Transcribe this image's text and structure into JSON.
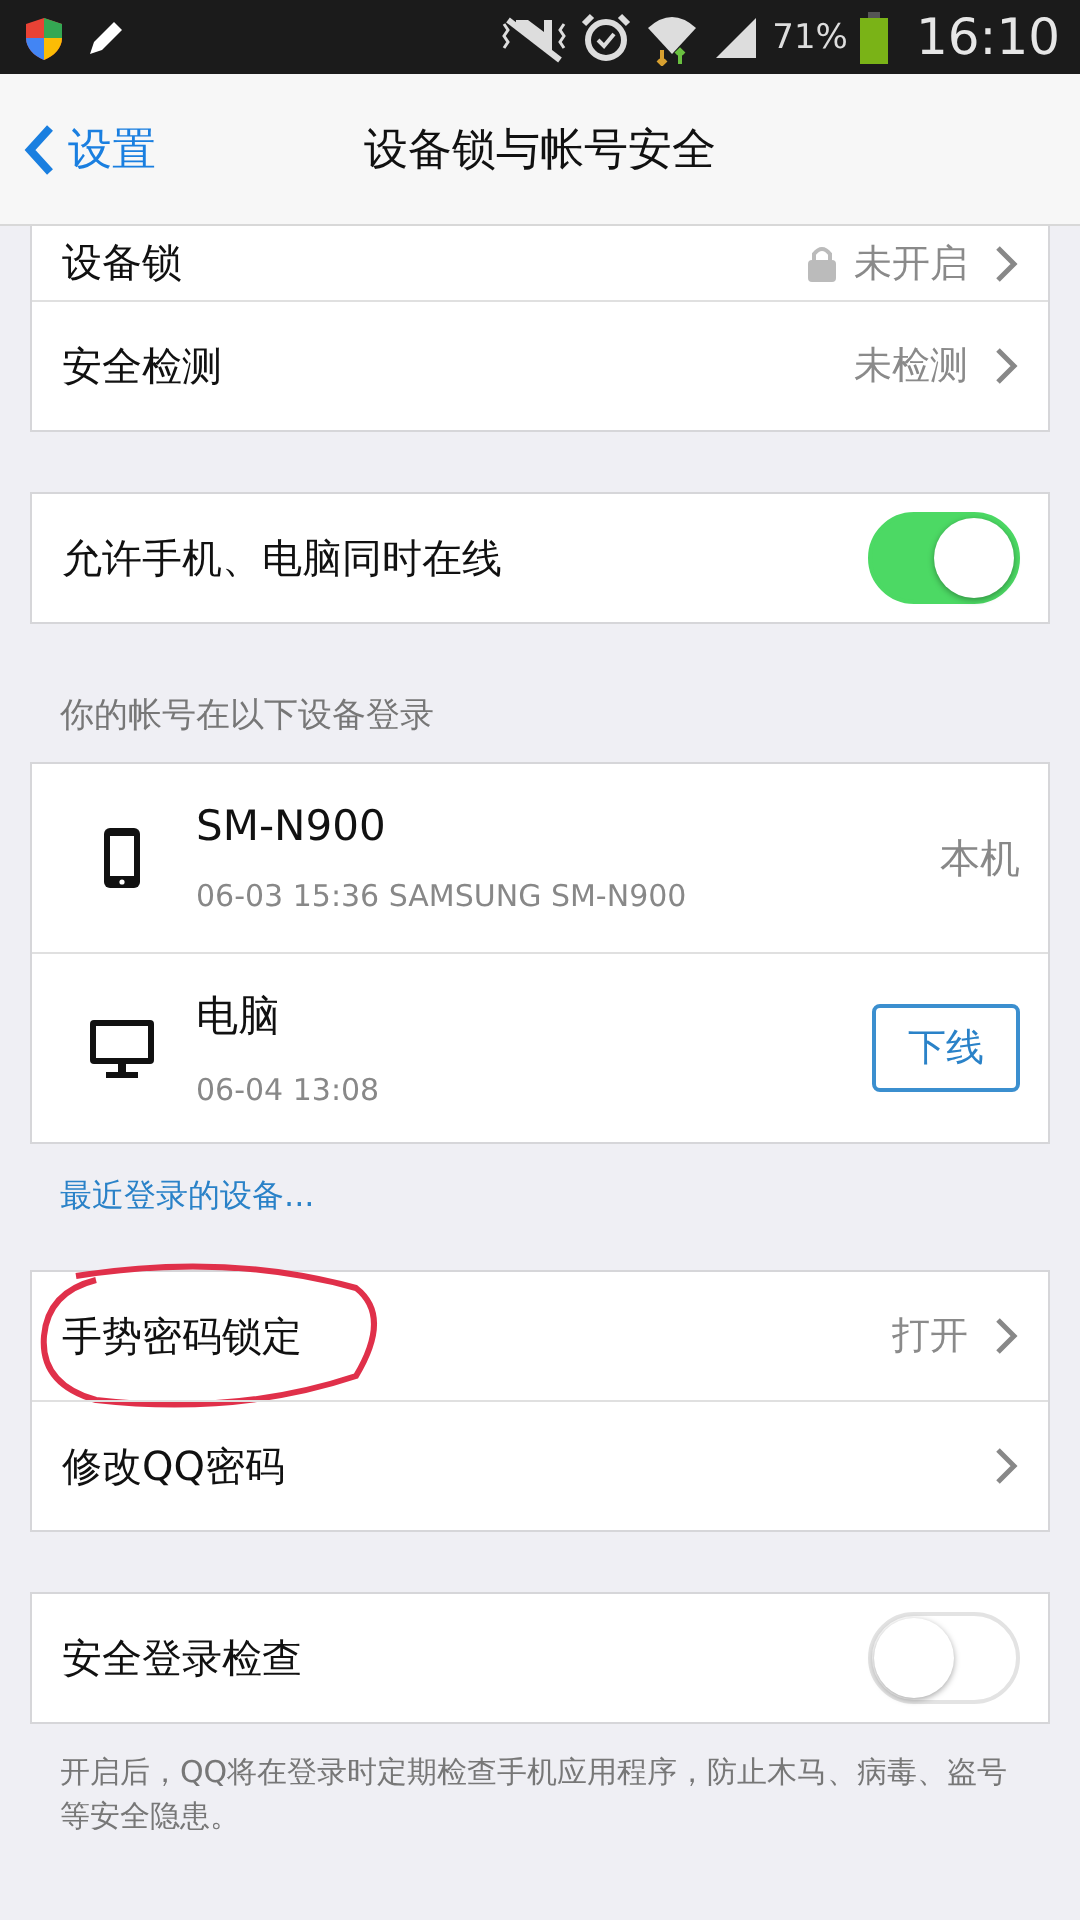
{
  "status_bar": {
    "battery": "71%",
    "time": "16:10"
  },
  "nav": {
    "back": "设置",
    "title": "设备锁与帐号安全"
  },
  "sections": [
    {
      "kind": "card",
      "rows": [
        {
          "kind": "locked",
          "label": "设备锁",
          "value": "未开启"
        },
        {
          "kind": "link",
          "label": "安全检测",
          "value": "未检测"
        }
      ]
    },
    {
      "kind": "card",
      "rows": [
        {
          "kind": "toggle",
          "label": "允许手机、电脑同时在线",
          "on": true
        }
      ]
    },
    {
      "kind": "header",
      "text": "你的帐号在以下设备登录"
    },
    {
      "kind": "devices",
      "items": [
        {
          "kind": "phone",
          "name": "SM-N900",
          "detail": "06-03 15:36 SAMSUNG SM-N900",
          "note": "本机"
        },
        {
          "kind": "desktop",
          "name": "电脑",
          "detail": "06-04 13:08",
          "button": "下线"
        }
      ]
    },
    {
      "kind": "more",
      "text": "最近登录的设备..."
    },
    {
      "kind": "card",
      "rows": [
        {
          "kind": "link",
          "label": "手势密码锁定",
          "value": "打开",
          "circled": true
        },
        {
          "kind": "link",
          "label": "修改QQ密码"
        }
      ]
    },
    {
      "kind": "card",
      "rows": [
        {
          "kind": "toggle",
          "label": "安全登录检查",
          "on": false
        }
      ]
    },
    {
      "kind": "note",
      "text": "开启后，QQ将在登录时定期检查手机应用程序，防止木马、病毒、盗号等安全隐患。"
    }
  ]
}
